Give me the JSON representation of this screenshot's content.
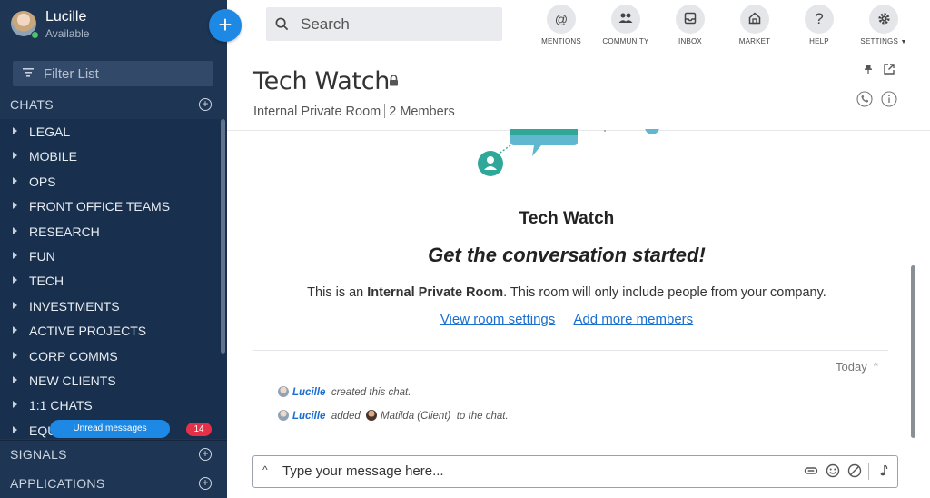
{
  "user": {
    "name": "Lucille",
    "status": "Available"
  },
  "sidebar": {
    "filter_placeholder": "Filter List",
    "chats_label": "CHATS",
    "groups": [
      "LEGAL",
      "MOBILE",
      "OPS",
      "FRONT OFFICE TEAMS",
      "RESEARCH",
      "FUN",
      "TECH",
      "INVESTMENTS",
      "ACTIVE PROJECTS",
      "CORP COMMS",
      "NEW CLIENTS",
      "1:1 CHATS",
      "EQU"
    ],
    "unread_label": "Unread messages",
    "unread_count": "14",
    "signals_label": "SIGNALS",
    "applications_label": "APPLICATIONS"
  },
  "topbar": {
    "search_placeholder": "Search",
    "nav": [
      {
        "label": "MENTIONS",
        "icon": "at-icon"
      },
      {
        "label": "COMMUNITY",
        "icon": "community-icon"
      },
      {
        "label": "INBOX",
        "icon": "inbox-icon"
      },
      {
        "label": "MARKET",
        "icon": "market-icon"
      },
      {
        "label": "HELP",
        "icon": "help-icon"
      },
      {
        "label": "SETTINGS",
        "icon": "gear-icon"
      }
    ]
  },
  "room": {
    "title": "Tech Watch",
    "type": "Internal Private Room",
    "members": "2 Members"
  },
  "welcome": {
    "title": "Tech Watch",
    "tagline": "Get the conversation started!",
    "desc_prefix": "This is an ",
    "desc_bold": "Internal Private Room",
    "desc_suffix": ". This room will only include people from your company.",
    "link_settings": "View room settings",
    "link_members": "Add more members"
  },
  "timeline": {
    "today_label": "Today",
    "events": [
      {
        "actor": "Lucille",
        "text": "created this chat."
      },
      {
        "actor": "Lucille",
        "verb": "added",
        "target": "Matilda (Client)",
        "text": "to the chat."
      }
    ]
  },
  "composer": {
    "placeholder": "Type your message here..."
  },
  "colors": {
    "sidebar_bg": "#1e3553",
    "accent": "#1e88e5",
    "badge": "#e53047",
    "link": "#1a6fd1",
    "illustration_teal": "#2fa89a"
  }
}
